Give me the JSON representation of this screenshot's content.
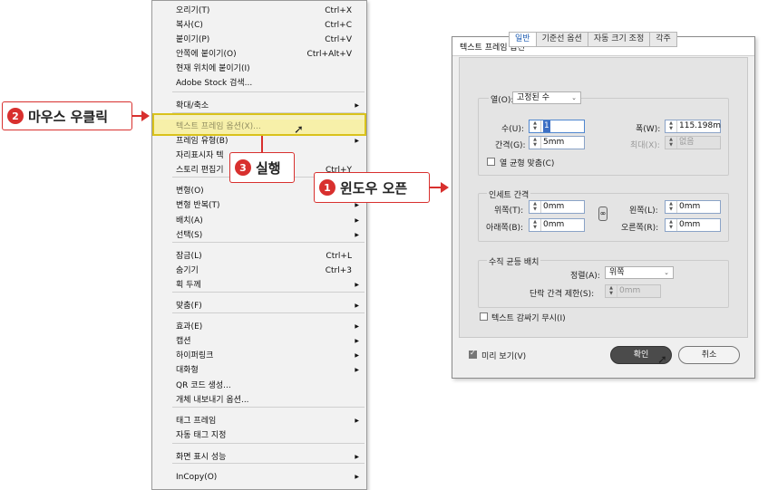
{
  "menu": {
    "items": [
      {
        "label": "오리기(T)",
        "shortcut": "Ctrl+X",
        "submenu": false
      },
      {
        "label": "복사(C)",
        "shortcut": "Ctrl+C",
        "submenu": false
      },
      {
        "label": "붙이기(P)",
        "shortcut": "Ctrl+V",
        "submenu": false
      },
      {
        "label": "안쪽에 붙이기(O)",
        "shortcut": "Ctrl+Alt+V",
        "submenu": false
      },
      {
        "label": "현재 위치에 붙이기(I)",
        "shortcut": "",
        "submenu": false
      },
      {
        "label": "Adobe Stock 검색...",
        "shortcut": "",
        "submenu": false
      },
      {
        "label": "확대/축소",
        "shortcut": "",
        "submenu": true
      },
      {
        "label": "텍스트 프레임 옵션(X)...",
        "shortcut": "",
        "submenu": false
      },
      {
        "label": "프레임 유형(B)",
        "shortcut": "",
        "submenu": true
      },
      {
        "label": "자리표시자 텍",
        "shortcut": "",
        "submenu": false
      },
      {
        "label": "스토리 편집기",
        "shortcut": "Ctrl+Y",
        "submenu": false
      },
      {
        "label": "변형(O)",
        "shortcut": "",
        "submenu": true
      },
      {
        "label": "변형 반복(T)",
        "shortcut": "",
        "submenu": true
      },
      {
        "label": "배치(A)",
        "shortcut": "",
        "submenu": true
      },
      {
        "label": "선택(S)",
        "shortcut": "",
        "submenu": true
      },
      {
        "label": "잠금(L)",
        "shortcut": "Ctrl+L",
        "submenu": false
      },
      {
        "label": "숨기기",
        "shortcut": "Ctrl+3",
        "submenu": false
      },
      {
        "label": "획 두께",
        "shortcut": "",
        "submenu": true
      },
      {
        "label": "맞춤(F)",
        "shortcut": "",
        "submenu": true
      },
      {
        "label": "효과(E)",
        "shortcut": "",
        "submenu": true
      },
      {
        "label": "캡션",
        "shortcut": "",
        "submenu": true
      },
      {
        "label": "하이퍼링크",
        "shortcut": "",
        "submenu": true
      },
      {
        "label": "대화형",
        "shortcut": "",
        "submenu": true
      },
      {
        "label": "QR 코드 생성...",
        "shortcut": "",
        "submenu": false
      },
      {
        "label": "개체 내보내기 옵션...",
        "shortcut": "",
        "submenu": false
      },
      {
        "label": "태그 프레임",
        "shortcut": "",
        "submenu": true
      },
      {
        "label": "자동 태그 지정",
        "shortcut": "",
        "submenu": false
      },
      {
        "label": "화면 표시 성능",
        "shortcut": "",
        "submenu": true
      },
      {
        "label": "InCopy(O)",
        "shortcut": "",
        "submenu": true
      }
    ]
  },
  "callouts": {
    "right_click": {
      "num": "2",
      "text": "마우스 우클릭"
    },
    "execute": {
      "num": "3",
      "text": "실행"
    },
    "window_open": {
      "num": "1",
      "text": "윈도우 오픈"
    }
  },
  "dialog": {
    "title": "텍스트 프레임 옵션",
    "tabs": [
      "일반",
      "기준선 옵션",
      "자동 크기 조정",
      "각주"
    ],
    "columns": {
      "label": "열(O):",
      "select_value": "고정된 수",
      "number_label": "수(U):",
      "number_value": "1",
      "width_label": "폭(W):",
      "width_value": "115.198m",
      "gutter_label": "간격(G):",
      "gutter_value": "5mm",
      "max_label": "최대(X):",
      "max_value": "없음",
      "balance_label": "열 균형 맞춤(C)"
    },
    "inset": {
      "title": "인세트 간격",
      "top_label": "위쪽(T):",
      "top_value": "0mm",
      "bottom_label": "아래쪽(B):",
      "bottom_value": "0mm",
      "left_label": "왼쪽(L):",
      "left_value": "0mm",
      "right_label": "오른쪽(R):",
      "right_value": "0mm"
    },
    "vertical": {
      "title": "수직 균등 배치",
      "align_label": "정렬(A):",
      "align_value": "위쪽",
      "limit_label": "단락 간격 제한(S):",
      "limit_value": "0mm"
    },
    "ignore_wrap_label": "텍스트 감싸기 무시(I)",
    "preview_label": "미리 보기(V)",
    "ok_label": "확인",
    "cancel_label": "취소"
  },
  "colors": {
    "accent": "#d8302e",
    "highlight": "#d9c21b"
  }
}
